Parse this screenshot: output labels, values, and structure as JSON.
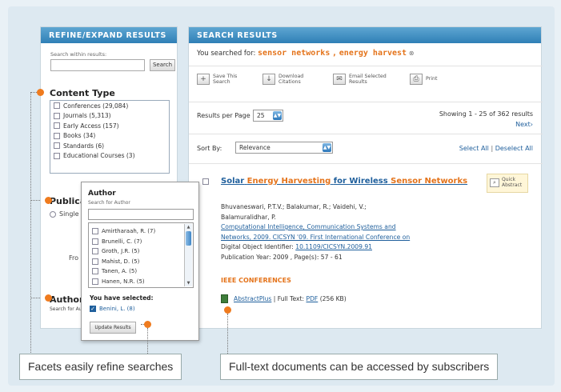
{
  "sidebar": {
    "header": "REFINE/EXPAND RESULTS",
    "search_within_label": "Search within results:",
    "search_button": "Search",
    "content_type": {
      "title": "Content Type",
      "items": [
        {
          "label": "Conferences (29,084)"
        },
        {
          "label": "Journals (5,313)"
        },
        {
          "label": "Early Access (157)"
        },
        {
          "label": "Books (34)"
        },
        {
          "label": "Standards (6)"
        },
        {
          "label": "Educational Courses (3)"
        }
      ]
    },
    "publication_year": {
      "title": "Publica",
      "single_label": "Single",
      "from_label": "Fro"
    },
    "author_facet": {
      "title": "Author",
      "search_label": "Search for Author"
    }
  },
  "author_popup": {
    "title": "Author",
    "search_label": "Search for Author",
    "items": [
      {
        "label": "Amirtharaah, R. (7)"
      },
      {
        "label": "Brunelli, C. (7)"
      },
      {
        "label": "Groth, J.R. (5)"
      },
      {
        "label": "Mahist, D. (5)"
      },
      {
        "label": "Tanen, A. (5)"
      },
      {
        "label": "Hanen, N.R. (5)"
      }
    ],
    "selected_heading": "You have selected:",
    "selected_item": "Benini, L. (8)",
    "update_button": "Update Results"
  },
  "main": {
    "header": "SEARCH RESULTS",
    "searched_for_prefix": "You searched for:",
    "term1": "sensor networks",
    "term_separator": ",",
    "term2": "energy harvest",
    "toolbar": [
      {
        "icon": "save-icon",
        "label1": "Save This",
        "label2": "Search"
      },
      {
        "icon": "download-icon",
        "label1": "Download",
        "label2": "Citations"
      },
      {
        "icon": "email-icon",
        "label1": "Email Selected",
        "label2": "Results"
      },
      {
        "icon": "print-icon",
        "label1": "Print",
        "label2": ""
      }
    ],
    "results_per_page_label": "Results per Page",
    "results_per_page_value": "25",
    "showing": "Showing 1 - 25 of 362 results",
    "next_link": "Next›",
    "sort_label": "Sort By:",
    "sort_value": "Relevance",
    "select_all": "Select All",
    "select_sep": "|",
    "deselect_all": "Deselect All",
    "result": {
      "title_part1": "Solar",
      "title_part2": "Energy Harvesting",
      "title_part3": "for Wireless",
      "title_part4": "Sensor",
      "title_part5": "Networks",
      "authors_line1": "Bhuvaneswari, P.T.V.; Balakumar, R.; Vaidehi, V.;",
      "authors_line2": "Balamuralidhar, P.",
      "pub_line1": "Computational Intelligence, Communication Systems and",
      "pub_line2": "Networks, 2009. CICSYN '09. First International Conference on",
      "doi_label": "Digital Object Identifier:",
      "doi": "10.1109/CICSYN.2009.91",
      "year_line": "Publication Year: 2009 , Page(s): 57 - 61",
      "venue": "IEEE CONFERENCES",
      "abstract_link": "AbstractPlus",
      "fulltext_label": "| Full Text:",
      "pdf_link": "PDF",
      "pdf_size": "(256 KB)",
      "quick_abstract_1": "Quick",
      "quick_abstract_2": "Abstract"
    }
  },
  "callouts": {
    "left": "Facets easily refine searches",
    "right": "Full-text documents can be accessed by subscribers"
  },
  "colors": {
    "accent": "#e4731a",
    "header_blue": "#2f7fb6",
    "link_blue": "#1f5f9c"
  }
}
